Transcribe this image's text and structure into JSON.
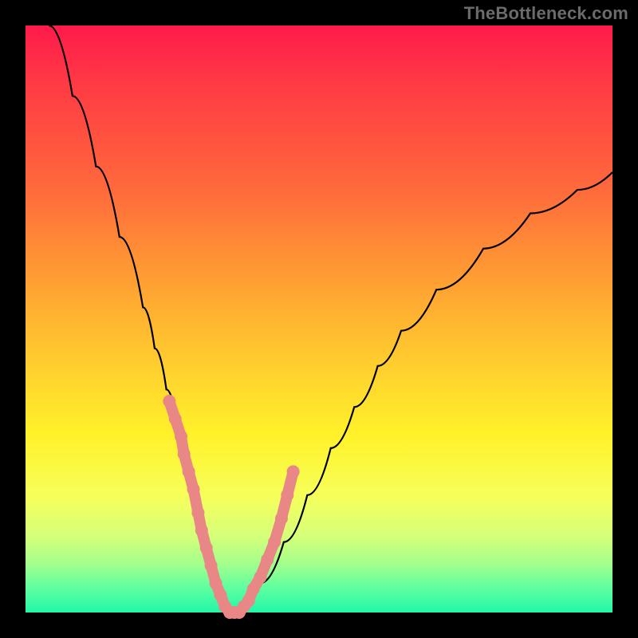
{
  "watermark": "TheBottleneck.com",
  "colors": {
    "background": "#000000",
    "gradient_top": "#ff1a4b",
    "gradient_mid": "#fff22a",
    "gradient_bottom": "#22f7a8",
    "curve": "#000000",
    "marker": "#e98787"
  },
  "chart_data": {
    "type": "line",
    "title": "",
    "xlabel": "",
    "ylabel": "",
    "xlim": [
      0,
      100
    ],
    "ylim": [
      0,
      100
    ],
    "grid": false,
    "legend": false,
    "series": [
      {
        "name": "bottleneck-curve",
        "x": [
          4,
          8,
          12,
          16,
          20,
          22,
          24,
          26,
          28,
          30,
          31,
          32,
          33,
          34,
          35,
          36,
          37,
          38,
          40,
          44,
          48,
          52,
          56,
          60,
          64,
          70,
          78,
          86,
          94,
          100
        ],
        "y": [
          100,
          88,
          76,
          64,
          52,
          45,
          38,
          31,
          23,
          14,
          10,
          6,
          3,
          1,
          0,
          0,
          1,
          2,
          5,
          12,
          20,
          28,
          35,
          42,
          48,
          55,
          62,
          68,
          72,
          75
        ]
      }
    ],
    "markers": {
      "name": "highlighted-points",
      "x": [
        24.5,
        25.5,
        26.5,
        27.0,
        27.8,
        28.6,
        29.4,
        30.0,
        30.8,
        31.6,
        32.4,
        33.2,
        34.0,
        34.8,
        35.6,
        36.4,
        37.2,
        38.0,
        38.8,
        40.0,
        41.2,
        42.4,
        43.6,
        44.6,
        45.6
      ],
      "y": [
        36,
        33,
        30,
        27,
        24,
        21,
        17,
        14,
        11,
        8,
        5,
        3,
        1,
        0,
        0,
        0,
        1,
        2,
        4,
        6,
        9,
        12,
        16,
        20,
        24
      ]
    }
  }
}
